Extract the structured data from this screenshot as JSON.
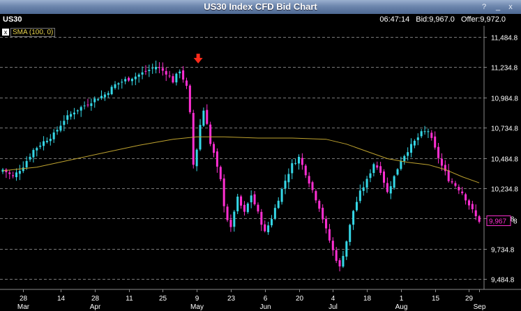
{
  "window": {
    "title": "US30 Index CFD Bid Chart",
    "help": "?",
    "minimize": "_",
    "close": "x"
  },
  "info": {
    "symbol": "US30",
    "time": "06:47:14",
    "bid": "Bid:9,967.0",
    "offer": "Offer:9,972.0"
  },
  "sma": {
    "icon": "x",
    "label": "SMA (100, 0)",
    "color": "#bfa32f"
  },
  "colors": {
    "up": "#35d7e6",
    "down": "#ff2fd2",
    "current_price_box": "#ff2fd2",
    "marker": "#ff2a1a"
  },
  "chart_data": {
    "type": "candlestick",
    "ylim": [
      9400,
      11560
    ],
    "yticks": [
      9484.8,
      9734.8,
      9984.8,
      10234.8,
      10484.8,
      10734.8,
      10984.8,
      11234.8,
      11484.8
    ],
    "ytick_labels": [
      "9,484.8",
      "9,734.8",
      "9,984.8",
      "10,234.8",
      "10,484.8",
      "10,734.8",
      "10,984.8",
      "11,234.8",
      "11,484.8"
    ],
    "current_price": 9967,
    "current_price_label": "9,967",
    "current_price_suffix": "8",
    "date_labels": [
      {
        "day": "28",
        "month": "Mar",
        "index": 6
      },
      {
        "day": "14",
        "month": "",
        "index": 17
      },
      {
        "day": "28",
        "month": "Apr",
        "index": 27
      },
      {
        "day": "11",
        "month": "",
        "index": 37
      },
      {
        "day": "25",
        "month": "",
        "index": 47
      },
      {
        "day": "9",
        "month": "May",
        "index": 57
      },
      {
        "day": "23",
        "month": "",
        "index": 67
      },
      {
        "day": "6",
        "month": "Jun",
        "index": 77
      },
      {
        "day": "20",
        "month": "",
        "index": 87
      },
      {
        "day": "4",
        "month": "Jul",
        "index": 97
      },
      {
        "day": "18",
        "month": "",
        "index": 107
      },
      {
        "day": "1",
        "month": "Aug",
        "index": 117
      },
      {
        "day": "15",
        "month": "",
        "index": 127
      },
      {
        "day": "29",
        "month": "",
        "index": 137
      },
      {
        "day": "",
        "month": "Sep",
        "index": 140
      }
    ],
    "marker_index": 57,
    "anchors": [
      [
        0,
        10390
      ],
      [
        3,
        10330
      ],
      [
        6,
        10420
      ],
      [
        9,
        10550
      ],
      [
        12,
        10620
      ],
      [
        15,
        10680
      ],
      [
        18,
        10800
      ],
      [
        21,
        10870
      ],
      [
        24,
        10920
      ],
      [
        27,
        10970
      ],
      [
        30,
        11010
      ],
      [
        33,
        11090
      ],
      [
        36,
        11130
      ],
      [
        39,
        11160
      ],
      [
        42,
        11200
      ],
      [
        45,
        11240
      ],
      [
        48,
        11190
      ],
      [
        50,
        11120
      ],
      [
        52,
        11210
      ],
      [
        54,
        11070
      ],
      [
        55,
        10850
      ],
      [
        56,
        10430
      ],
      [
        57,
        10560
      ],
      [
        58,
        10760
      ],
      [
        59,
        10880
      ],
      [
        60,
        10780
      ],
      [
        61,
        10600
      ],
      [
        62,
        10520
      ],
      [
        63,
        10400
      ],
      [
        64,
        10300
      ],
      [
        65,
        10100
      ],
      [
        66,
        9980
      ],
      [
        67,
        9900
      ],
      [
        68,
        10050
      ],
      [
        69,
        10150
      ],
      [
        71,
        10030
      ],
      [
        73,
        10180
      ],
      [
        75,
        10030
      ],
      [
        77,
        9870
      ],
      [
        79,
        9990
      ],
      [
        81,
        10150
      ],
      [
        83,
        10300
      ],
      [
        85,
        10430
      ],
      [
        87,
        10490
      ],
      [
        89,
        10360
      ],
      [
        91,
        10220
      ],
      [
        93,
        10080
      ],
      [
        95,
        9890
      ],
      [
        97,
        9720
      ],
      [
        99,
        9580
      ],
      [
        101,
        9800
      ],
      [
        103,
        10050
      ],
      [
        105,
        10200
      ],
      [
        107,
        10300
      ],
      [
        109,
        10440
      ],
      [
        111,
        10380
      ],
      [
        113,
        10200
      ],
      [
        115,
        10330
      ],
      [
        117,
        10470
      ],
      [
        119,
        10550
      ],
      [
        121,
        10620
      ],
      [
        123,
        10690
      ],
      [
        125,
        10710
      ],
      [
        127,
        10560
      ],
      [
        129,
        10420
      ],
      [
        131,
        10310
      ],
      [
        133,
        10260
      ],
      [
        135,
        10200
      ],
      [
        137,
        10100
      ],
      [
        139,
        10000
      ],
      [
        140,
        9967
      ]
    ],
    "sma_series": [
      [
        0,
        10380
      ],
      [
        10,
        10410
      ],
      [
        20,
        10470
      ],
      [
        30,
        10530
      ],
      [
        40,
        10590
      ],
      [
        50,
        10640
      ],
      [
        57,
        10660
      ],
      [
        65,
        10660
      ],
      [
        75,
        10650
      ],
      [
        85,
        10650
      ],
      [
        95,
        10640
      ],
      [
        101,
        10600
      ],
      [
        107,
        10540
      ],
      [
        113,
        10480
      ],
      [
        119,
        10450
      ],
      [
        125,
        10430
      ],
      [
        130,
        10390
      ],
      [
        135,
        10330
      ],
      [
        140,
        10280
      ]
    ]
  }
}
